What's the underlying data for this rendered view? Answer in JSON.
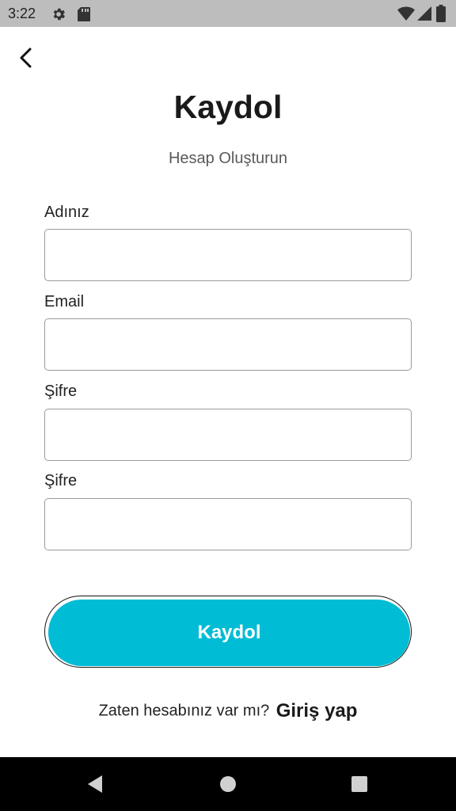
{
  "status_bar": {
    "time": "3:22",
    "icons": [
      "gear-icon",
      "sd-card-icon",
      "wifi-icon",
      "signal-icon",
      "battery-icon"
    ]
  },
  "header": {
    "back_icon": "chevron-left-icon",
    "title": "Kaydol",
    "subtitle": "Hesap Oluşturun"
  },
  "form": {
    "fields": [
      {
        "label": "Adınız",
        "value": "",
        "placeholder": ""
      },
      {
        "label": "Email",
        "value": "",
        "placeholder": ""
      },
      {
        "label": "Şifre",
        "value": "",
        "placeholder": ""
      },
      {
        "label": "Şifre",
        "value": "",
        "placeholder": ""
      }
    ],
    "submit_label": "Kaydol"
  },
  "footer": {
    "question": "Zaten hesabınız var mı?",
    "login_link": "Giriş yap"
  },
  "colors": {
    "accent": "#00bcd4",
    "status_bar": "#bdbdbd",
    "nav_bar": "#000000"
  },
  "nav_bar": {
    "icons": [
      "back-triangle-icon",
      "home-circle-icon",
      "recents-square-icon"
    ]
  }
}
